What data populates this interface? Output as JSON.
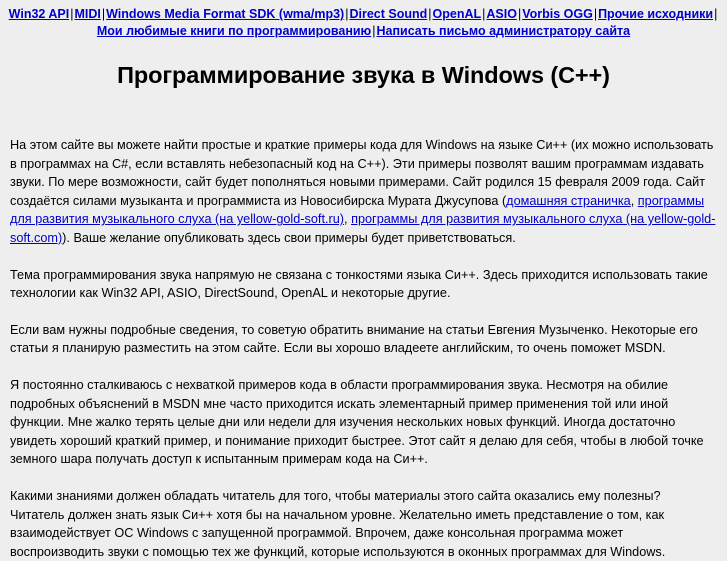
{
  "colors": {
    "background": "#eeeeee",
    "text": "#000000",
    "link": "#0000cc"
  },
  "nav": {
    "separator": "|",
    "items": [
      {
        "label": "Win32 API"
      },
      {
        "label": "MIDI"
      },
      {
        "label": "Windows Media Format SDK (wma/mp3)"
      },
      {
        "label": "Direct Sound"
      },
      {
        "label": "OpenAL"
      },
      {
        "label": "ASIO"
      },
      {
        "label": "Vorbis OGG"
      },
      {
        "label": "Прочие исходники"
      },
      {
        "label": "Мои любимые книги по программированию"
      },
      {
        "label": "Написать письмо администратору сайта"
      }
    ]
  },
  "heading": {
    "title": "Программирование звука в Windows (C++)"
  },
  "paragraphs": {
    "p1": {
      "part1": "На этом сайте вы можете найти простые и краткие примеры кода для Windows на языке Си++ (их можно использовать в программах на C#, если вставлять небезопасный код на C++). Эти примеры позволят вашим программам издавать звуки. По мере возможности, сайт будет пополняться новыми примерами. Сайт родился 15 февраля 2009 года. Сайт создаётся силами музыканта и программиста из Новосибирска Мурата Джусупова (",
      "link1": "домашняя страничка",
      "part2": ", ",
      "link2": "программы для развития музыкального слуха (на yellow-gold-soft.ru)",
      "part3": ", ",
      "link3": "программы для развития музыкального слуха (на yellow-gold-soft.com)",
      "part4": "). Ваше желание опубликовать здесь свои примеры будет приветствоваться."
    },
    "p2": "Тема программирования звука напрямую не связана с тонкостями языка Си++. Здесь приходится использовать такие технологии как Win32 API, ASIO, DirectSound, OpenAL и некоторые другие.",
    "p3": "Если вам нужны подробные сведения, то советую обратить внимание на статьи Евгения Музыченко. Некоторые его статьи я планирую разместить на этом сайте. Если вы хорошо владеете английским, то очень поможет MSDN.",
    "p4": "Я постоянно сталкиваюсь с нехваткой примеров кода в области программирования звука. Несмотря на обилие подробных объяснений в MSDN мне часто приходится искать элементарный пример применения той или иной функции. Мне жалко терять целые дни или недели для изучения нескольких новых функций. Иногда достаточно увидеть хороший краткий пример, и понимание приходит быстрее. Этот сайт я делаю для себя, чтобы в любой точке земного шара получать доступ к испытанным примерам кода на Си++.",
    "p5": "Какими знаниями должен обладать читатель для того, чтобы материалы этого сайта оказались ему полезны? Читатель должен знать язык Си++ хотя бы на начальном уровне. Желательно иметь представление о том, как взаимодействует ОС Windows с запущенной программой. Впрочем, даже консольная программа может воспроизводить звуки с помощью тех же функций, которые используются в оконных программах для Windows."
  }
}
